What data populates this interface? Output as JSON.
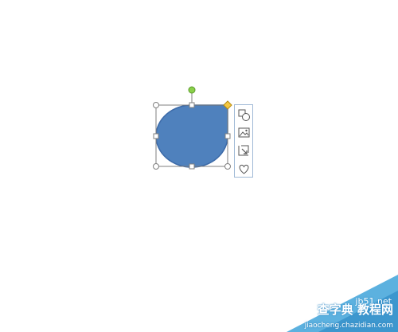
{
  "shape": {
    "fill_color": "#4f81bd",
    "outline_color": "#3c6aa8",
    "selection_color": "#7f7f7f",
    "rotation_handle_color": "#8ad04a",
    "adjust_handle_color": "#f5c842"
  },
  "toolbar": {
    "icons": [
      "shape-icon",
      "picture-icon",
      "crop-resize-icon",
      "heart-shape-icon"
    ],
    "accent": "#5b8ec8"
  },
  "watermark": {
    "site": "jb51.net",
    "main": "查字典 教程网",
    "url": "jiaocheng.chazidian.com",
    "color": "#4aa8dc"
  }
}
